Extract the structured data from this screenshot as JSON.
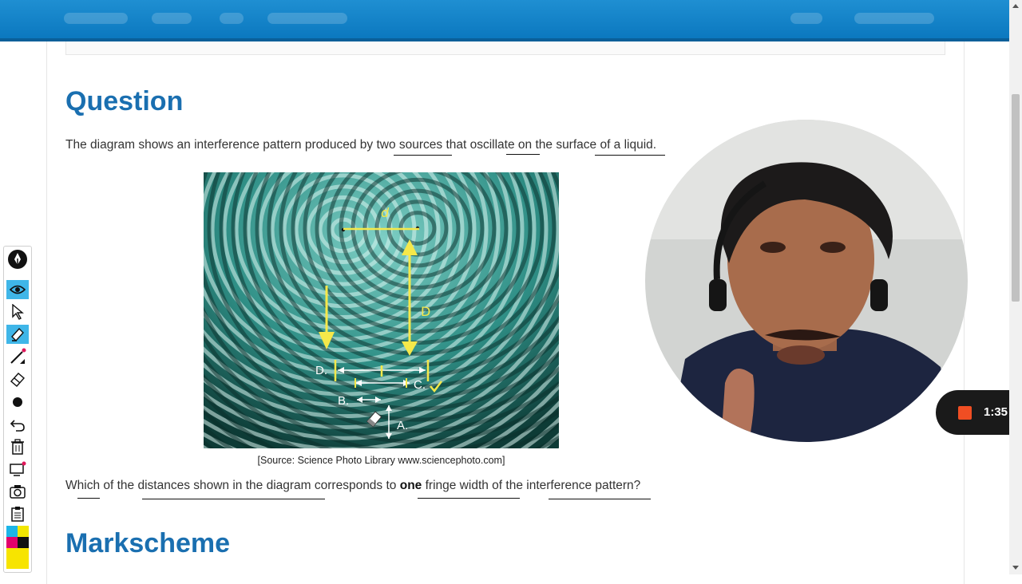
{
  "question": {
    "heading": "Question",
    "intro": "The diagram shows an interference pattern produced by two sources that oscillate on the surface of a liquid.",
    "figure_labels": {
      "d": "d",
      "D": "D",
      "A": "A.",
      "B": "B.",
      "C": "C.",
      "Dpt": "D."
    },
    "caption": "[Source: Science Photo Library www.sciencephoto.com]",
    "prompt_before": "Which of the distances shown in the diagram corresponds to ",
    "prompt_bold": "one",
    "prompt_after": " fringe width of the interference pattern?"
  },
  "markscheme": {
    "heading": "Markscheme"
  },
  "recording": {
    "time": "1:35"
  },
  "toolbar": {
    "tools": [
      "pen-logo-icon",
      "eye-icon",
      "pointer-icon",
      "highlighter-icon",
      "pen-icon",
      "eraser-icon",
      "dot-icon",
      "undo-icon",
      "trash-icon",
      "screen-icon",
      "camera-icon",
      "clipboard-icon",
      "color-palette-icon"
    ]
  },
  "colors": {
    "accent": "#1a6fb0",
    "annotation": "#f5e84a",
    "record": "#f04e23"
  }
}
